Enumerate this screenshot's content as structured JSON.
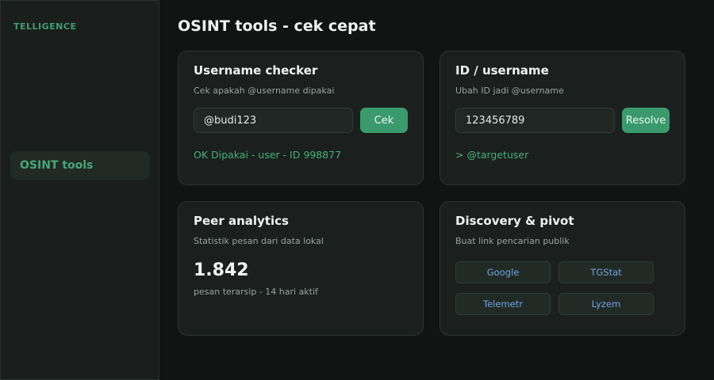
{
  "sidebar": {
    "brand": "TELLIGENCE",
    "items": [
      {
        "label": "OSINT tools",
        "active": true
      }
    ]
  },
  "page": {
    "title": "OSINT tools - cek cepat"
  },
  "username_checker": {
    "title": "Username checker",
    "subtitle": "Cek apakah @username dipakai",
    "input_value": "@budi123",
    "button_label": "Cek",
    "result": "OK Dipakai - user - ID 998877"
  },
  "id_resolver": {
    "title": "ID / username",
    "subtitle": "Ubah ID jadi @username",
    "input_value": "123456789",
    "button_label": "Resolve",
    "result": "> @targetuser"
  },
  "peer_analytics": {
    "title": "Peer analytics",
    "subtitle": "Statistik pesan dari data lokal",
    "value": "1.842",
    "note": "pesan terarsip - 14 hari aktif"
  },
  "discovery": {
    "title": "Discovery & pivot",
    "subtitle": "Buat link pencarian publik",
    "links": [
      "Google",
      "TGStat",
      "Telemetr",
      "Lyzem"
    ]
  },
  "colors": {
    "accent": "#3a9a6c",
    "success_text": "#45b07c",
    "link": "#6ea6de",
    "background": "#111413"
  }
}
